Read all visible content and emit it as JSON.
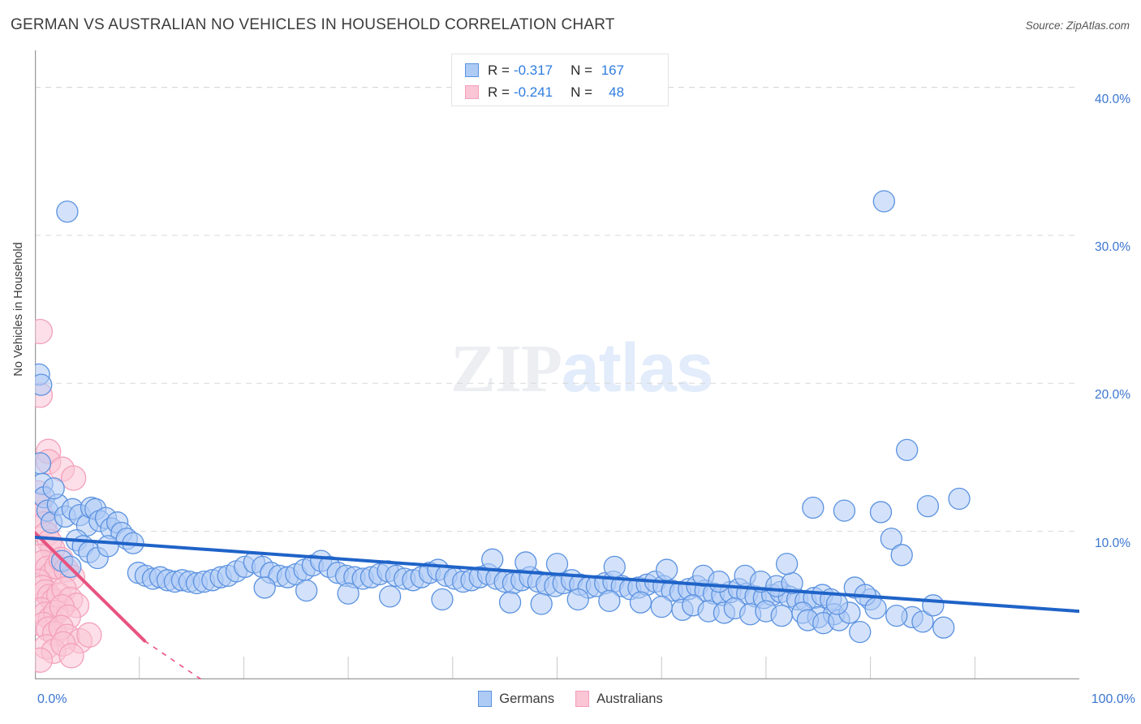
{
  "header": {
    "title": "GERMAN VS AUSTRALIAN NO VEHICLES IN HOUSEHOLD CORRELATION CHART",
    "source": "Source: ZipAtlas.com"
  },
  "watermark": {
    "part1": "ZIP",
    "part2": "atlas"
  },
  "axes": {
    "y_title": "No Vehicles in Household",
    "x_min_label": "0.0%",
    "x_max_label": "100.0%",
    "y_tick_labels": [
      "40.0%",
      "30.0%",
      "20.0%",
      "10.0%"
    ]
  },
  "stats_legend": {
    "rows": [
      {
        "series": "Germans",
        "r_label": "R =",
        "r_value": "-0.317",
        "n_label": "N =",
        "n_value": "167",
        "color": "#aecbf5"
      },
      {
        "series": "Australians",
        "r_label": "R =",
        "r_value": "-0.241",
        "n_label": "N =",
        "n_value": "48",
        "color": "#fac5d5"
      }
    ]
  },
  "series_legend": [
    {
      "label": "Germans",
      "color": "#aecbf5",
      "border": "#5b92e0"
    },
    {
      "label": "Australians",
      "color": "#fac5d5",
      "border": "#f3a0bb"
    }
  ],
  "colors": {
    "blue_fill": "#aecbf5",
    "blue_stroke": "#5b92e0",
    "blue_line": "#1f63c8",
    "pink_fill": "#fac5d5",
    "pink_stroke": "#f3a0bb",
    "pink_line": "#e8537f",
    "grid": "#d8d8d8",
    "axis": "#9a9a9a",
    "tick_text": "#3a75d0"
  },
  "chart_data": {
    "type": "scatter",
    "title": "GERMAN VS AUSTRALIAN NO VEHICLES IN HOUSEHOLD CORRELATION CHART",
    "xlabel": "",
    "ylabel": "No Vehicles in Household",
    "xlim": [
      0,
      100
    ],
    "ylim": [
      0,
      42.5
    ],
    "x_ticks": [
      0,
      10,
      20,
      30,
      40,
      50,
      60,
      70,
      80,
      90,
      100
    ],
    "y_gridlines": [
      10,
      20,
      30,
      40
    ],
    "grid": true,
    "legend_position": "bottom",
    "series": [
      {
        "name": "Germans",
        "color": "#aecbf5",
        "stroke": "#5b92e0",
        "r": -0.317,
        "n": 167,
        "trendline": {
          "x0": 0,
          "y0": 9.6,
          "x1": 100,
          "y1": 4.6,
          "style": "solid",
          "color": "#1f63c8"
        },
        "points": [
          [
            3.1,
            31.6
          ],
          [
            0.4,
            20.6
          ],
          [
            0.6,
            19.9
          ],
          [
            0.5,
            14.6
          ],
          [
            0.7,
            13.2
          ],
          [
            0.9,
            12.3
          ],
          [
            1.2,
            11.4
          ],
          [
            1.6,
            10.6
          ],
          [
            2.2,
            11.8
          ],
          [
            2.9,
            11.0
          ],
          [
            3.6,
            11.5
          ],
          [
            4.3,
            11.1
          ],
          [
            5.0,
            10.4
          ],
          [
            5.4,
            11.6
          ],
          [
            5.8,
            11.5
          ],
          [
            6.2,
            10.7
          ],
          [
            6.8,
            10.9
          ],
          [
            7.3,
            10.2
          ],
          [
            7.9,
            10.6
          ],
          [
            8.3,
            9.9
          ],
          [
            4.0,
            9.4
          ],
          [
            4.6,
            9.0
          ],
          [
            5.2,
            8.6
          ],
          [
            6.0,
            8.2
          ],
          [
            7.0,
            9.0
          ],
          [
            8.8,
            9.5
          ],
          [
            9.4,
            9.2
          ],
          [
            2.6,
            8.0
          ],
          [
            3.4,
            7.6
          ],
          [
            1.8,
            12.9
          ],
          [
            9.9,
            7.2
          ],
          [
            10.6,
            7.0
          ],
          [
            11.3,
            6.8
          ],
          [
            12.0,
            6.9
          ],
          [
            12.7,
            6.7
          ],
          [
            13.4,
            6.6
          ],
          [
            14.1,
            6.7
          ],
          [
            14.8,
            6.6
          ],
          [
            15.5,
            6.5
          ],
          [
            16.2,
            6.6
          ],
          [
            17.0,
            6.7
          ],
          [
            17.8,
            6.9
          ],
          [
            18.5,
            7.0
          ],
          [
            19.3,
            7.3
          ],
          [
            20.1,
            7.6
          ],
          [
            21.0,
            7.9
          ],
          [
            21.8,
            7.6
          ],
          [
            22.6,
            7.2
          ],
          [
            23.4,
            7.0
          ],
          [
            24.2,
            6.9
          ],
          [
            25.0,
            7.1
          ],
          [
            25.8,
            7.4
          ],
          [
            26.6,
            7.7
          ],
          [
            27.4,
            8.0
          ],
          [
            28.2,
            7.6
          ],
          [
            29.0,
            7.2
          ],
          [
            29.8,
            7.0
          ],
          [
            30.6,
            6.9
          ],
          [
            31.4,
            6.8
          ],
          [
            32.2,
            6.9
          ],
          [
            33.0,
            7.1
          ],
          [
            33.8,
            7.3
          ],
          [
            34.6,
            7.0
          ],
          [
            35.4,
            6.8
          ],
          [
            36.2,
            6.7
          ],
          [
            37.0,
            6.9
          ],
          [
            37.8,
            7.2
          ],
          [
            38.6,
            7.4
          ],
          [
            39.4,
            7.0
          ],
          [
            40.2,
            6.8
          ],
          [
            41.0,
            6.6
          ],
          [
            41.8,
            6.7
          ],
          [
            42.6,
            6.9
          ],
          [
            43.4,
            7.1
          ],
          [
            44.2,
            6.8
          ],
          [
            45.0,
            6.6
          ],
          [
            45.8,
            6.5
          ],
          [
            46.6,
            6.7
          ],
          [
            47.4,
            6.9
          ],
          [
            48.2,
            6.6
          ],
          [
            49.0,
            6.4
          ],
          [
            49.8,
            6.3
          ],
          [
            50.6,
            6.5
          ],
          [
            51.4,
            6.7
          ],
          [
            52.2,
            6.4
          ],
          [
            53.0,
            6.2
          ],
          [
            53.8,
            6.3
          ],
          [
            54.6,
            6.5
          ],
          [
            55.4,
            6.6
          ],
          [
            56.2,
            6.3
          ],
          [
            57.0,
            6.1
          ],
          [
            57.8,
            6.2
          ],
          [
            58.6,
            6.4
          ],
          [
            59.4,
            6.6
          ],
          [
            60.2,
            6.3
          ],
          [
            61.0,
            6.0
          ],
          [
            61.8,
            5.9
          ],
          [
            62.6,
            6.1
          ],
          [
            63.4,
            6.3
          ],
          [
            64.2,
            6.0
          ],
          [
            65.0,
            5.8
          ],
          [
            65.8,
            5.7
          ],
          [
            66.6,
            5.9
          ],
          [
            67.4,
            6.1
          ],
          [
            68.2,
            5.8
          ],
          [
            69.0,
            5.6
          ],
          [
            69.8,
            5.5
          ],
          [
            70.6,
            5.7
          ],
          [
            71.4,
            5.9
          ],
          [
            72.2,
            5.6
          ],
          [
            73.0,
            5.4
          ],
          [
            73.8,
            5.3
          ],
          [
            74.6,
            5.5
          ],
          [
            75.4,
            5.7
          ],
          [
            76.2,
            5.4
          ],
          [
            43.8,
            8.1
          ],
          [
            47.0,
            7.9
          ],
          [
            50.0,
            7.8
          ],
          [
            52.0,
            5.4
          ],
          [
            55.0,
            5.3
          ],
          [
            58.0,
            5.2
          ],
          [
            60.0,
            4.9
          ],
          [
            62.0,
            4.7
          ],
          [
            63.0,
            5.0
          ],
          [
            64.5,
            4.6
          ],
          [
            66.0,
            4.5
          ],
          [
            67.0,
            4.8
          ],
          [
            68.5,
            4.4
          ],
          [
            70.0,
            4.6
          ],
          [
            71.5,
            4.3
          ],
          [
            73.5,
            4.5
          ],
          [
            75.0,
            4.2
          ],
          [
            76.5,
            4.4
          ],
          [
            60.5,
            7.4
          ],
          [
            64.0,
            7.0
          ],
          [
            65.5,
            6.6
          ],
          [
            68.0,
            7.0
          ],
          [
            69.5,
            6.6
          ],
          [
            71.0,
            6.3
          ],
          [
            72.5,
            6.5
          ],
          [
            74.0,
            4.0
          ],
          [
            75.5,
            3.8
          ],
          [
            77.0,
            4.0
          ],
          [
            78.0,
            4.5
          ],
          [
            79.0,
            3.2
          ],
          [
            80.0,
            5.4
          ],
          [
            81.0,
            11.3
          ],
          [
            82.0,
            9.5
          ],
          [
            83.0,
            8.4
          ],
          [
            84.0,
            4.2
          ],
          [
            85.0,
            3.9
          ],
          [
            86.0,
            5.0
          ],
          [
            87.0,
            3.5
          ],
          [
            81.3,
            32.3
          ],
          [
            83.5,
            15.5
          ],
          [
            85.5,
            11.7
          ],
          [
            88.5,
            12.2
          ],
          [
            77.5,
            11.4
          ],
          [
            74.5,
            11.6
          ],
          [
            72.0,
            7.8
          ],
          [
            78.5,
            6.2
          ],
          [
            79.5,
            5.7
          ],
          [
            76.8,
            5.1
          ],
          [
            80.5,
            4.8
          ],
          [
            82.5,
            4.3
          ],
          [
            55.5,
            7.6
          ],
          [
            48.5,
            5.1
          ],
          [
            45.5,
            5.2
          ],
          [
            39.0,
            5.4
          ],
          [
            34.0,
            5.6
          ],
          [
            30.0,
            5.8
          ],
          [
            26.0,
            6.0
          ],
          [
            22.0,
            6.2
          ]
        ]
      },
      {
        "name": "Australians",
        "color": "#fac5d5",
        "stroke": "#f3a0bb",
        "r": -0.241,
        "n": 48,
        "trendline": {
          "x0": 0,
          "y0": 9.9,
          "x1": 10.5,
          "y1": 2.6,
          "style": "solid-then-dashed",
          "dash_x1": 18.0,
          "dash_y1": -1.0,
          "color": "#e8537f"
        },
        "points": [
          [
            0.5,
            23.5
          ],
          [
            0.5,
            19.2
          ],
          [
            1.3,
            15.4
          ],
          [
            1.3,
            14.7
          ],
          [
            2.6,
            14.2
          ],
          [
            3.7,
            13.6
          ],
          [
            0.3,
            12.6
          ],
          [
            0.4,
            11.8
          ],
          [
            0.6,
            11.1
          ],
          [
            0.9,
            10.5
          ],
          [
            1.1,
            9.8
          ],
          [
            1.4,
            9.3
          ],
          [
            1.7,
            8.8
          ],
          [
            0.5,
            8.3
          ],
          [
            0.8,
            7.9
          ],
          [
            1.2,
            7.5
          ],
          [
            1.6,
            7.1
          ],
          [
            2.1,
            7.6
          ],
          [
            2.5,
            8.1
          ],
          [
            3.0,
            7.4
          ],
          [
            3.6,
            6.9
          ],
          [
            0.4,
            6.6
          ],
          [
            0.7,
            6.2
          ],
          [
            1.0,
            5.9
          ],
          [
            1.4,
            5.6
          ],
          [
            1.8,
            5.3
          ],
          [
            2.3,
            5.7
          ],
          [
            2.8,
            6.1
          ],
          [
            3.4,
            5.4
          ],
          [
            4.0,
            5.0
          ],
          [
            0.6,
            4.7
          ],
          [
            1.0,
            4.4
          ],
          [
            1.5,
            4.1
          ],
          [
            2.0,
            4.5
          ],
          [
            2.6,
            4.9
          ],
          [
            3.2,
            4.2
          ],
          [
            0.8,
            3.7
          ],
          [
            1.3,
            3.4
          ],
          [
            1.9,
            3.1
          ],
          [
            2.5,
            3.5
          ],
          [
            3.1,
            2.9
          ],
          [
            4.3,
            2.6
          ],
          [
            5.2,
            3.0
          ],
          [
            1.1,
            2.2
          ],
          [
            1.8,
            1.9
          ],
          [
            2.7,
            2.4
          ],
          [
            3.5,
            1.6
          ],
          [
            0.5,
            1.3
          ]
        ]
      }
    ]
  }
}
